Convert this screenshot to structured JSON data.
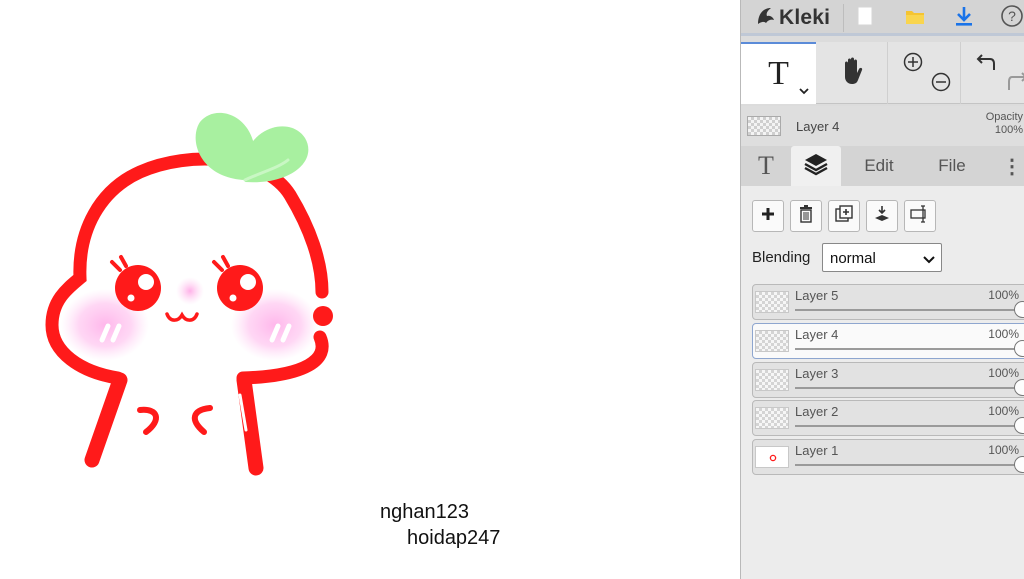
{
  "canvas": {
    "text_line_1": "nghan123",
    "text_line_2": "hoidap247",
    "stroke_color": "#ff1a1a",
    "leaf_color": "#a8f0a0",
    "blush_color": "#ffb3ea"
  },
  "topbar": {
    "app_name": "Kleki",
    "icons": [
      "kleki-logo-icon",
      "new-file-icon",
      "open-folder-icon",
      "download-icon",
      "help-icon"
    ]
  },
  "tools": {
    "active_tool": "text",
    "text_tool_glyph": "T",
    "items": [
      "text-tool-icon",
      "hand-tool-icon",
      "zoom-in-icon",
      "zoom-out-icon",
      "undo-icon",
      "redo-icon"
    ]
  },
  "layer_info": {
    "name": "Layer 4",
    "opacity_label": "Opacity",
    "opacity_value": "100%"
  },
  "tabs": {
    "brush_glyph": "T",
    "edit": "Edit",
    "file": "File",
    "more": "⋮",
    "active": "layers"
  },
  "layers": {
    "buttons": [
      "add-layer-icon",
      "delete-layer-icon",
      "duplicate-layer-icon",
      "merge-layer-icon",
      "rename-layer-icon"
    ],
    "blending_label": "Blending",
    "blending_value": "normal",
    "items": [
      {
        "name": "Layer 5",
        "opacity": "100%",
        "active": false
      },
      {
        "name": "Layer 4",
        "opacity": "100%",
        "active": true
      },
      {
        "name": "Layer 3",
        "opacity": "100%",
        "active": false
      },
      {
        "name": "Layer 2",
        "opacity": "100%",
        "active": false
      },
      {
        "name": "Layer 1",
        "opacity": "100%",
        "active": false
      }
    ]
  },
  "colors": {
    "panel_bg": "#dcdcdc",
    "active_accent": "#5b8bd8",
    "download_blue": "#1a73e8",
    "folder_yellow": "#f5c431"
  }
}
